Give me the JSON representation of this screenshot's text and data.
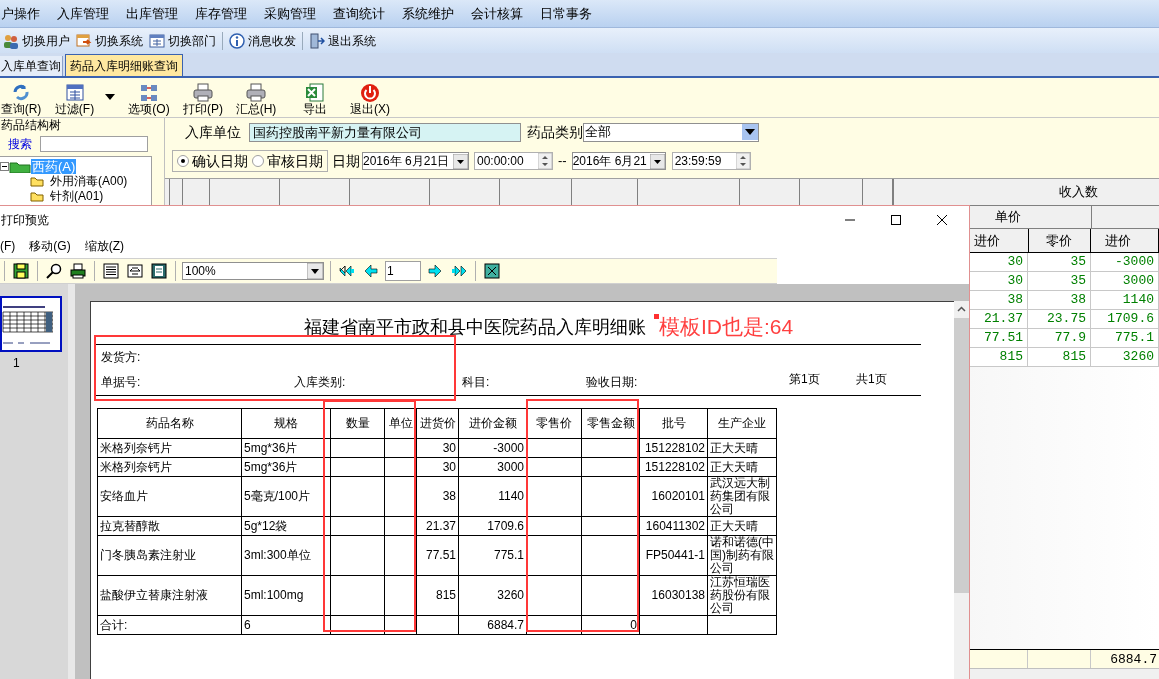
{
  "menu_bar": [
    "户操作",
    "入库管理",
    "出库管理",
    "库存管理",
    "采购管理",
    "查询统计",
    "系统维护",
    "会计核算",
    "日常事务"
  ],
  "toolbar": [
    "切换用户",
    "切换系统",
    "切换部门",
    "消息收发",
    "退出系统"
  ],
  "tabs": [
    {
      "label": "入库单查询",
      "selected": false
    },
    {
      "label": "药品入库明细账查询",
      "selected": true
    }
  ],
  "actions": [
    {
      "kind": "button",
      "label": "查询(R)"
    },
    {
      "kind": "button",
      "label": "过滤(F)"
    },
    {
      "kind": "dropdown"
    },
    {
      "kind": "button",
      "label": "选项(O)"
    },
    {
      "kind": "button",
      "label": "打印(P)"
    },
    {
      "kind": "button",
      "label": "汇总(H)"
    },
    {
      "kind": "button",
      "label": "导出"
    },
    {
      "kind": "button",
      "label": "退出(X)"
    }
  ],
  "tree": {
    "title": "药品结构树",
    "search_label": "搜索",
    "items": [
      {
        "label": "西药(A)",
        "selected": true,
        "expanded": true,
        "children": [
          {
            "label": "外用消毒(A00)",
            "selected": false
          },
          {
            "label": "针剂(A01)",
            "selected": false
          }
        ]
      }
    ]
  },
  "filter": {
    "unit_label": "入库单位",
    "unit_value": "国药控股南平新力量有限公司",
    "category_label": "药品类别",
    "category_value": "全部",
    "date_types": [
      {
        "label": "确认日期",
        "selected": true
      },
      {
        "label": "审核日期",
        "selected": false
      }
    ],
    "date_label": "日期",
    "start_date": "2016年 6月21日",
    "start_time": "00:00:00",
    "separator": "--",
    "end_date": "2016年 6月21",
    "end_time": "23:59:59"
  },
  "grid": {
    "group_header": "收入数",
    "sub_header": "单价",
    "columns": [
      "进价",
      "零价",
      "进价"
    ],
    "rows": [
      {
        "purchase": "30",
        "retail": "35",
        "amount": "-3000"
      },
      {
        "purchase": "30",
        "retail": "35",
        "amount": "3000"
      },
      {
        "purchase": "38",
        "retail": "38",
        "amount": "1140"
      },
      {
        "purchase": "21.37",
        "retail": "23.75",
        "amount": "1709.6"
      },
      {
        "purchase": "77.51",
        "retail": "77.9",
        "amount": "775.1"
      },
      {
        "purchase": "815",
        "retail": "815",
        "amount": "3260"
      }
    ],
    "footer": {
      "amount": "6884.7"
    }
  },
  "preview": {
    "title": "打印预览",
    "menu": [
      "(F)",
      "移动(G)",
      "缩放(Z)"
    ],
    "zoom": "100%",
    "page": "1",
    "thumbnail_label": "1",
    "report": {
      "title": "福建省南平市政和县中医院药品入库明细账",
      "note": "模板ID也是:64",
      "supplier_label": "发货方:",
      "fields": [
        "单据号:",
        "入库类别:",
        "科目:",
        "验收日期:"
      ],
      "page_info": [
        "第1页",
        "共1页"
      ],
      "columns": [
        "药品名称",
        "规格",
        "数量",
        "单位",
        "进货价",
        "进价金额",
        "零售价",
        "零售金额",
        "批号",
        "生产企业"
      ],
      "rows": [
        {
          "name": "米格列奈钙片",
          "spec": "5mg*36片",
          "purchase_price": "30",
          "purchase_amount": "-3000",
          "batch": "151228102",
          "maker": "正大天晴"
        },
        {
          "name": "米格列奈钙片",
          "spec": "5mg*36片",
          "purchase_price": "30",
          "purchase_amount": "3000",
          "batch": "151228102",
          "maker": "正大天晴"
        },
        {
          "name": "安络血片",
          "spec": "5毫克/100片",
          "purchase_price": "38",
          "purchase_amount": "1140",
          "batch": "16020101",
          "maker": "武汉远大制药集团有限公司"
        },
        {
          "name": "拉克替醇散",
          "spec": "5g*12袋",
          "purchase_price": "21.37",
          "purchase_amount": "1709.6",
          "batch": "160411302",
          "maker": "正大天晴"
        },
        {
          "name": "门冬胰岛素注射业",
          "spec": "3ml:300单位",
          "purchase_price": "77.51",
          "purchase_amount": "775.1",
          "batch": "FP50441-1",
          "maker": "诺和诺德(中国)制药有限公司"
        },
        {
          "name": "盐酸伊立替康注射液",
          "spec": "5ml:100mg",
          "purchase_price": "815",
          "purchase_amount": "3260",
          "batch": "16030138",
          "maker": "江苏恒瑞医药股份有限公司"
        }
      ],
      "total": {
        "name": "合计:",
        "spec": "6",
        "purchase_amount": "6884.7",
        "retail_amount": "0"
      }
    }
  }
}
